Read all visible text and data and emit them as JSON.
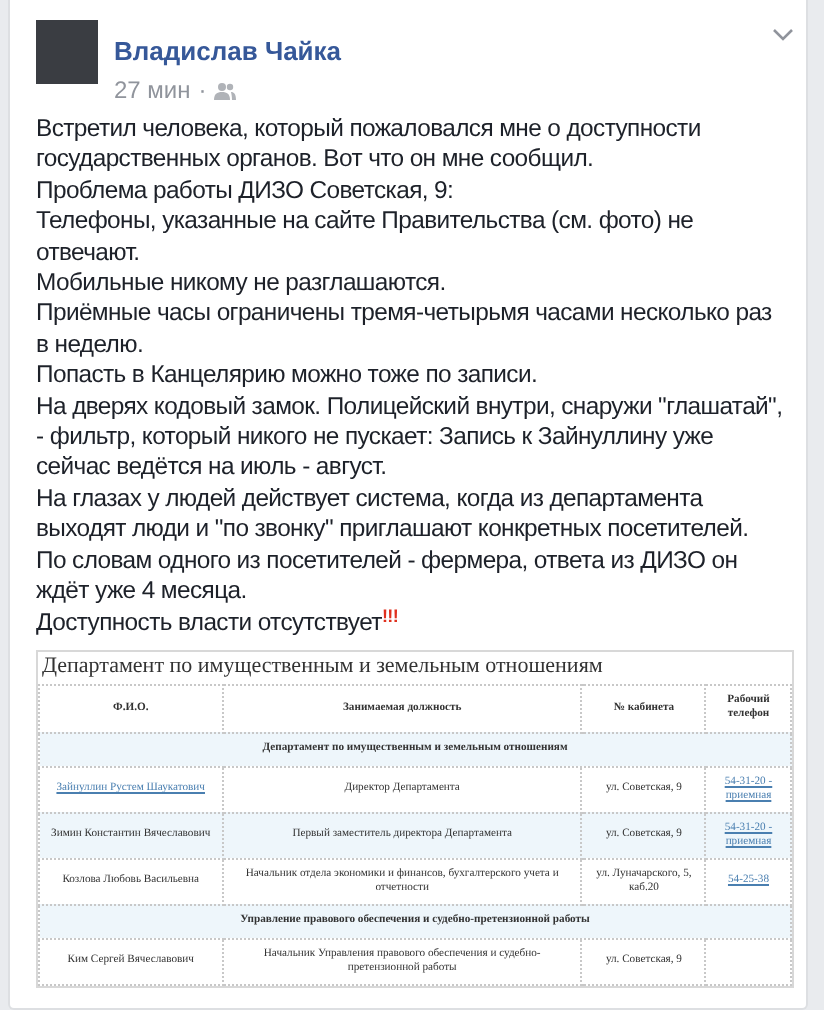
{
  "post": {
    "author": "Владислав Чайка",
    "time": "27 мин",
    "separator": "·",
    "paragraphs": [
      "Встретил человека, который пожаловался мне о доступности государственных органов. Вот что он мне сообщил.",
      "Проблема работы ДИЗО Советская, 9:",
      "Телефоны, указанные на сайте Правительства (см. фото) не отвечают.",
      "Мобильные никому не разглашаются.",
      "Приёмные часы ограничены тремя-четырьмя часами несколько раз в неделю.",
      "Попасть в Канцелярию можно тоже по записи.",
      "На дверях кодовый замок. Полицейский внутри, снаружи \"глашатай\", - фильтр, который никого не пускает: Запись к Зайнуллину уже сейчас ведётся на июль - август.",
      "На глазах у людей действует система, когда из департамента выходят люди и \"по звонку\" приглашают конкретных посетителей.",
      "По словам одного из посетителей - фермера, ответа из ДИЗО он ждёт уже 4 месяца."
    ],
    "closing": "Доступность власти отсутствует",
    "closing_mark": "!!!"
  },
  "document": {
    "title": "Департамент по имущественным и земельным отношениям",
    "columns": [
      "Ф.И.О.",
      "Занимаемая должность",
      "№ кабинета",
      "Рабочий телефон"
    ],
    "rows": [
      {
        "kind": "section",
        "text": "Департамент по имущественным и земельным отношениям"
      },
      {
        "kind": "person",
        "shaded": false,
        "name": "Зайнуллин Рустем Шаукатович",
        "linked": true,
        "position": "Директор Департамента",
        "office": "ул. Советская, 9",
        "phone": "54-31-20 - приемная"
      },
      {
        "kind": "person",
        "shaded": true,
        "name": "Зимин Константин Вячеславович",
        "linked": false,
        "position": "Первый заместитель директора Департамента",
        "office": "ул. Советская, 9",
        "phone": "54-31-20 - приемная"
      },
      {
        "kind": "person",
        "shaded": false,
        "name": "Козлова Любовь Васильевна",
        "linked": false,
        "position": "Начальник отдела экономики и финансов, бухгалтерского учета и отчетности",
        "office": "ул. Луначарского, 5, каб.20",
        "phone": "54-25-38"
      },
      {
        "kind": "section",
        "text": "Управление правового обеспечения и судебно-претензионной работы"
      },
      {
        "kind": "person",
        "shaded": false,
        "name": "Ким Сергей Вячеславович",
        "linked": false,
        "position": "Начальник Управления правового обеспечения и судебно-претензионной работы",
        "office": "ул. Советская, 9"
      }
    ]
  }
}
